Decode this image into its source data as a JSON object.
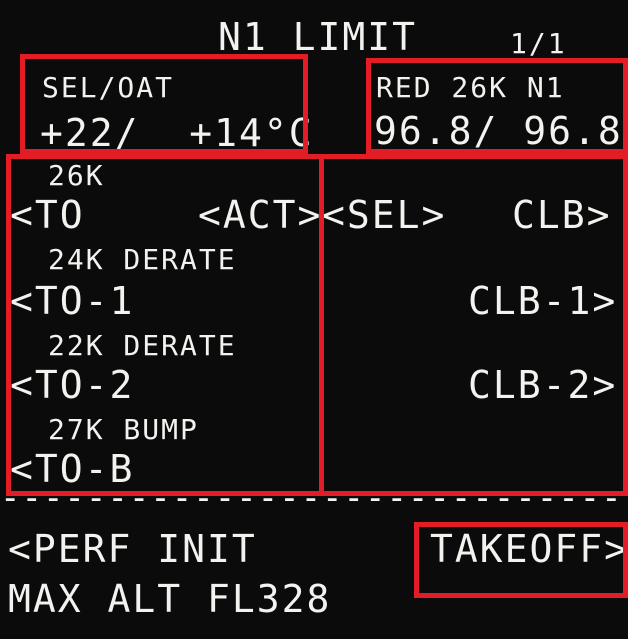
{
  "header": {
    "title": "N1 LIMIT",
    "page": "1/1"
  },
  "sel_oat": {
    "label": "SEL/OAT",
    "value": "+22/  +14°C"
  },
  "red_n1": {
    "label": "RED 26K N1",
    "value": "96.8/ 96.8"
  },
  "left": [
    {
      "caption": "26K",
      "key": "<TO",
      "status": "<ACT>"
    },
    {
      "caption": "24K DERATE",
      "key": "<TO-1"
    },
    {
      "caption": "22K DERATE",
      "key": "<TO-2"
    },
    {
      "caption": "27K BUMP",
      "key": "<TO-B"
    }
  ],
  "right": {
    "sel": "<SEL>",
    "clb": "CLB>",
    "clb1": "CLB-1>",
    "clb2": "CLB-2>"
  },
  "separator": "------------------------------------",
  "footer": {
    "perf_init": "<PERF INIT",
    "takeoff": "TAKEOFF>",
    "max_alt": "MAX ALT FL328"
  },
  "colors": {
    "text": "#f2f2ee",
    "background": "#0b0b0c",
    "highlight_box": "#e21d26"
  }
}
